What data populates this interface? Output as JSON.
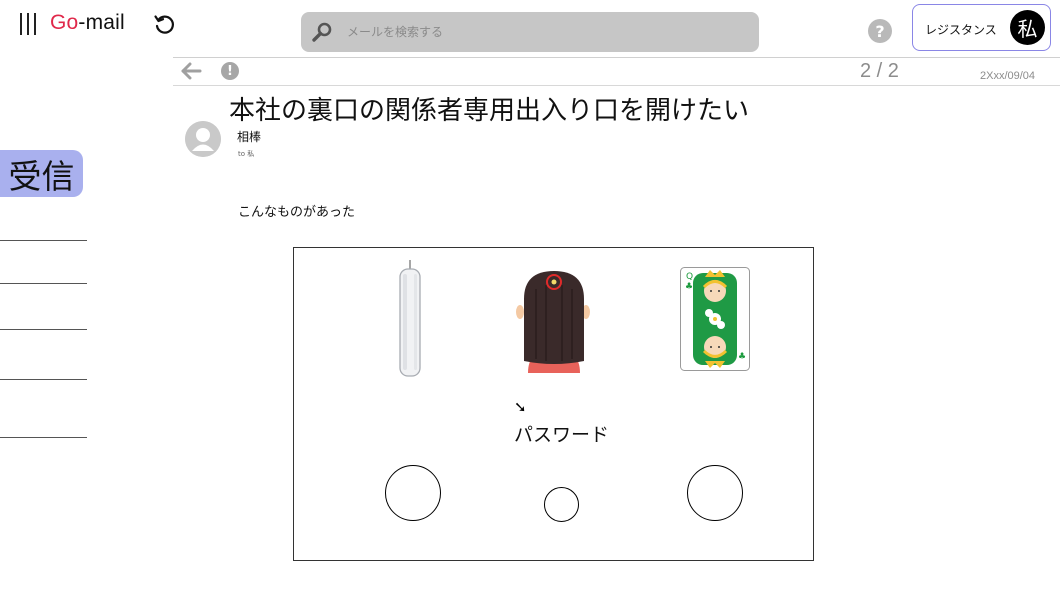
{
  "header": {
    "logo_prefix": "Go",
    "logo_suffix": "-mail",
    "search_placeholder": "メールを検索する",
    "account_name": "レジスタンス",
    "avatar_text": "私",
    "help_text": "?"
  },
  "toolbar": {
    "pager": "2 / 2",
    "date": "2Xxx/09/04",
    "report_text": "!"
  },
  "sidebar": {
    "inbox_label": "受信"
  },
  "email": {
    "subject": "本社の裏口の関係者専用出入り口を開けたい",
    "sender": "相棒",
    "recipient": "to 私",
    "body": "こんなものがあった",
    "puzzle": {
      "arrow": "➘",
      "password_label": "パスワード",
      "card_rank": "Q",
      "card_suit": "♣"
    }
  },
  "colors": {
    "logo_accent": "#e0284a",
    "inbox_highlight": "#a9b0ee",
    "account_border": "#8a86e6",
    "card_green": "#1a9a3c"
  }
}
